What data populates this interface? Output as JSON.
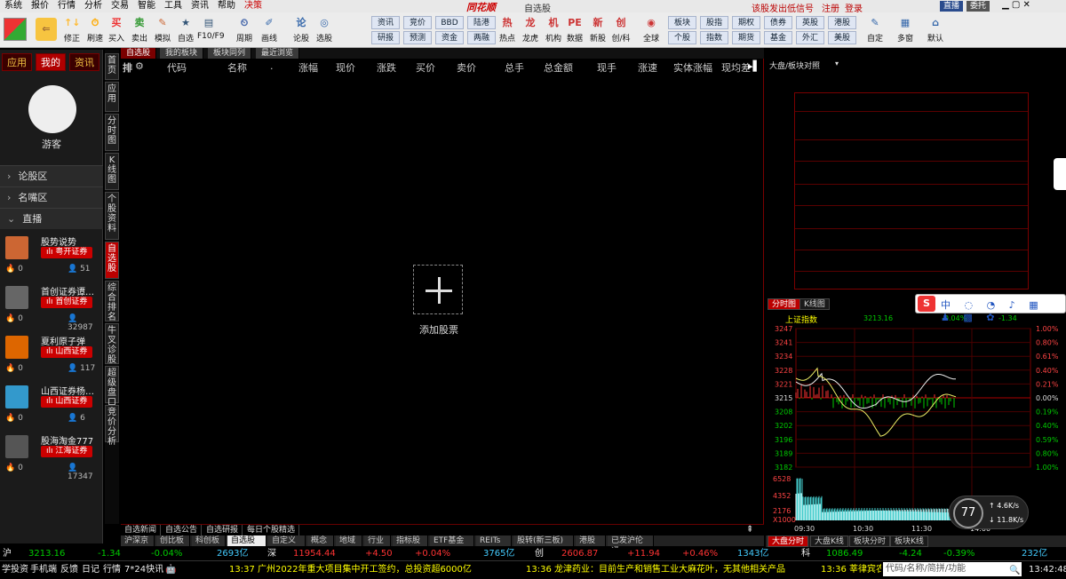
{
  "menu": {
    "items": [
      "系统",
      "报价",
      "行情",
      "分析",
      "交易",
      "智能",
      "工具",
      "资讯",
      "帮助"
    ],
    "special": "决策",
    "logo": "同花顺",
    "title": "自选股",
    "alert": "该股发出低信号",
    "register": "注册",
    "login": "登录",
    "btn1": "直播",
    "btn2": "委托"
  },
  "toolbar": {
    "big": [
      {
        "l": "修正",
        "i": "↑↓"
      },
      {
        "l": "刷速",
        "i": "⏱"
      },
      {
        "l": "买入",
        "i": "买"
      },
      {
        "l": "卖出",
        "i": "卖"
      },
      {
        "l": "模拟",
        "i": "✎"
      },
      {
        "l": "自选",
        "i": "★"
      },
      {
        "l": "F10/F9",
        "i": "▤"
      },
      {
        "l": "周期",
        "i": "⏲"
      },
      {
        "l": "画线",
        "i": "✐"
      },
      {
        "l": "论股",
        "i": "论"
      },
      {
        "l": "选股",
        "i": "◎"
      }
    ],
    "small_top": [
      "资讯",
      "竞价",
      "BBD",
      "陆港"
    ],
    "small_bot": [
      "研报",
      "预测",
      "资金",
      "两融"
    ],
    "mid": [
      {
        "l": "热点",
        "i": "热"
      },
      {
        "l": "龙虎",
        "i": "龙"
      },
      {
        "l": "机构",
        "i": "机"
      },
      {
        "l": "数据",
        "i": "PE"
      },
      {
        "l": "新股",
        "i": "新"
      },
      {
        "l": "创/科",
        "i": "创"
      },
      {
        "l": "全球",
        "i": "◉"
      }
    ],
    "grp_top": [
      "板块",
      "股指",
      "期权",
      "债券",
      "英股",
      "港股"
    ],
    "grp_bot": [
      "个股",
      "指数",
      "期货",
      "基金",
      "外汇",
      "美股"
    ],
    "right": [
      {
        "l": "自定",
        "i": "✎"
      },
      {
        "l": "多窗",
        "i": "▦"
      },
      {
        "l": "默认",
        "i": "⌂"
      }
    ]
  },
  "left": {
    "tabs": [
      "应用",
      "我的",
      "资讯"
    ],
    "user": "游客",
    "sections": [
      "论股区",
      "名嘴区",
      "直播"
    ],
    "lives": [
      {
        "name": "股势说势",
        "badge": "粤开证券",
        "likes": "0",
        "fans": "51",
        "color": "#c63"
      },
      {
        "name": "首创证券谭…",
        "badge": "首创证券",
        "likes": "0",
        "fans": "32987",
        "color": "#666"
      },
      {
        "name": "夏利原子弹",
        "badge": "山西证券",
        "likes": "0",
        "fans": "117",
        "color": "#d60"
      },
      {
        "name": "山西证券杨…",
        "badge": "山西证券",
        "likes": "0",
        "fans": "6",
        "color": "#39c"
      },
      {
        "name": "股海淘金777",
        "badge": "江海证券",
        "likes": "0",
        "fans": "17347",
        "color": "#555"
      }
    ]
  },
  "vtabs": [
    "首页",
    "应用",
    "分时图",
    "K线图",
    "个股资料",
    "自选股",
    "综合排名",
    "牛叉诊股",
    "超级盘口",
    "竞价分析"
  ],
  "strip": [
    "自选股",
    "我的板块",
    "板块同列",
    "最近浏览"
  ],
  "columns": [
    "代码",
    "名称",
    ".",
    "涨幅",
    "现价",
    "涨跌",
    "买价",
    "卖价",
    "总手",
    "总金额",
    "现手",
    "涨速",
    "实体涨幅",
    "现均差"
  ],
  "add_label": "添加股票",
  "news_tabs": [
    "自选新闻",
    "自选公告",
    "自选研报",
    "每日个股精选"
  ],
  "bottom_tabs": [
    "沪深京",
    "创比板",
    "科创板",
    "自选股",
    "自定义",
    "概念",
    "地域",
    "行业",
    "指标股",
    "ETF基金",
    "REITs",
    "股转(新三板)",
    "港股",
    "已发沪伦通"
  ],
  "right": {
    "title": "大盘/板块对照",
    "tabs": [
      "分时图",
      "K线图"
    ],
    "index_name": "上证指数",
    "index_price": "3213.16",
    "index_pct": "-0.04%",
    "index_chg": "-1.34",
    "y_left": [
      "3247",
      "3241",
      "3234",
      "3228",
      "3221",
      "3215",
      "3208",
      "3202",
      "3196",
      "3189",
      "3182"
    ],
    "y_right": [
      "1.00%",
      "0.80%",
      "0.61%",
      "0.40%",
      "0.21%",
      "0.00%",
      "0.19%",
      "0.40%",
      "0.59%",
      "0.80%",
      "1.00%"
    ],
    "vol_labels": [
      "6528",
      "4352",
      "2176",
      "X1000"
    ],
    "x_labels": [
      "09:30",
      "10:30",
      "11:30",
      "14:00"
    ],
    "bot_tabs": [
      "大盘分时",
      "大盘K线",
      "板块分时",
      "板块K线"
    ],
    "speed_pct": "77",
    "speed_up": "4.6",
    "speed_down": "11.8",
    "speed_unit": "K/s"
  },
  "indexbar": {
    "sh": "沪",
    "sh_price": "3213.16",
    "sh_chg": "-1.34",
    "sh_pct": "-0.04%",
    "sh_amt": "2693亿",
    "sz": "深",
    "sz_price": "11954.44",
    "sz_chg": "+4.50",
    "sz_pct": "+0.04%",
    "sz_amt": "3765亿",
    "cy": "创",
    "cy_price": "2606.87",
    "cy_chg": "+11.94",
    "cy_pct": "+0.46%",
    "cy_amt": "1343亿",
    "kc": "科",
    "kc_price": "1086.49",
    "kc_chg": "-4.24",
    "kc_pct": "-0.39%",
    "kc_amt": "232亿"
  },
  "ticker": {
    "items": [
      "学投资",
      "手机端",
      "反馈",
      "日记",
      "行情",
      "7*24快讯"
    ],
    "news1": "13:37 广州2022年重大项目集中开工签约，总投资超6000亿",
    "news2": "13:36 龙津药业：目前生产和销售工业大麻花叶，无其他相关产品",
    "news3": "13:36 莘律宾农",
    "search_ph": "代码/名称/简拼/功能",
    "time": "13:42:48"
  }
}
